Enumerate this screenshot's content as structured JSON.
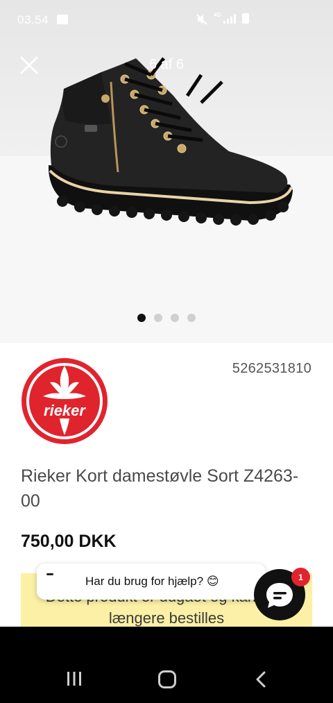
{
  "status_bar": {
    "time": "03.54",
    "network": "4G"
  },
  "gallery": {
    "counter": "6 af 6",
    "dots": 4,
    "active_dot": 0
  },
  "product": {
    "sku": "5262531810",
    "brand_logo_text": "rieker",
    "title": "Rieker Kort damestøvle Sort Z4263-00",
    "price": "750,00 DKK",
    "notice": "Dette produkt er udgået og kan ikke længere bestilles"
  },
  "chat": {
    "prompt": "Har du brug for hjælp? 😊",
    "badge_count": "1"
  },
  "colors": {
    "brand_red": "#e0242e",
    "notice_bg": "#fbf0a5",
    "chat_button": "#111111"
  }
}
